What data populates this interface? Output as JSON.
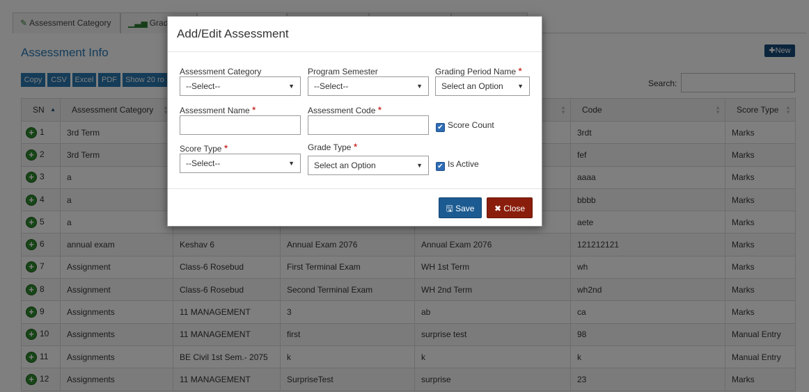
{
  "tabs": [
    {
      "label": "Assessment Category",
      "icon": "tag-icon"
    },
    {
      "label": "Grade I",
      "icon": "signal-bars-icon"
    },
    {
      "label": ""
    },
    {
      "label": ""
    },
    {
      "label": ""
    },
    {
      "label": ""
    }
  ],
  "panel": {
    "title": "Assessment Info",
    "new_label": "New"
  },
  "toolbar": {
    "buttons": [
      "Copy",
      "CSV",
      "Excel",
      "PDF",
      "Show 20 ro"
    ],
    "search_label": "Search:",
    "search_value": ""
  },
  "table": {
    "columns": [
      "SN",
      "Assessment Category",
      "",
      "",
      "",
      "Code",
      "Score Type"
    ],
    "rows": [
      [
        "1",
        "3rd Term",
        "",
        "",
        "",
        "3rdt",
        "Marks"
      ],
      [
        "2",
        "3rd Term",
        "",
        "",
        "",
        "fef",
        "Marks"
      ],
      [
        "3",
        "a",
        "",
        "",
        "",
        "aaaa",
        "Marks"
      ],
      [
        "4",
        "a",
        "",
        "",
        "",
        "bbbb",
        "Marks"
      ],
      [
        "5",
        "a",
        "",
        "",
        "",
        "aete",
        "Marks"
      ],
      [
        "6",
        "annual exam",
        "Keshav 6",
        "Annual Exam 2076",
        "Annual Exam 2076",
        "121212121",
        "Marks"
      ],
      [
        "7",
        "Assignment",
        "Class-6 Rosebud",
        "First Terminal Exam",
        "WH 1st Term",
        "wh",
        "Marks"
      ],
      [
        "8",
        "Assignment",
        "Class-6 Rosebud",
        "Second Terminal Exam",
        "WH 2nd Term",
        "wh2nd",
        "Marks"
      ],
      [
        "9",
        "Assignments",
        "11 MANAGEMENT",
        "3",
        "ab",
        "ca",
        "Marks"
      ],
      [
        "10",
        "Assignments",
        "11 MANAGEMENT",
        "first",
        "surprise test",
        "98",
        "Manual Entry"
      ],
      [
        "11",
        "Assignments",
        "BE Civil 1st Sem.- 2075",
        "k",
        "k",
        "k",
        "Manual Entry"
      ],
      [
        "12",
        "Assignments",
        "11 MANAGEMENT",
        "SurpriseTest",
        "surprise",
        "23",
        "Marks"
      ]
    ]
  },
  "modal": {
    "title": "Add/Edit Assessment",
    "fields": {
      "assessment_category": {
        "label": "Assessment Category",
        "value": "--Select--"
      },
      "program_semester": {
        "label": "Program Semester",
        "value": "--Select--"
      },
      "grading_period": {
        "label": "Grading Period Name",
        "value": "Select an Option"
      },
      "assessment_name": {
        "label": "Assessment Name",
        "value": ""
      },
      "assessment_code": {
        "label": "Assessment Code",
        "value": ""
      },
      "score_count": {
        "label": "Score Count",
        "checked": true
      },
      "score_type": {
        "label": "Score Type",
        "value": "--Select--"
      },
      "grade_type": {
        "label": "Grade Type",
        "value": "Select an Option"
      },
      "is_active": {
        "label": "Is Active",
        "checked": true
      }
    },
    "required_marker": "*",
    "save_label": "Save",
    "close_label": "Close"
  },
  "colors": {
    "accent_blue": "#2878b6",
    "save_button": "#1c5b91",
    "close_button": "#8a1e0c",
    "checkbox": "#2f6db5",
    "add_row": "#2e8b2e"
  }
}
